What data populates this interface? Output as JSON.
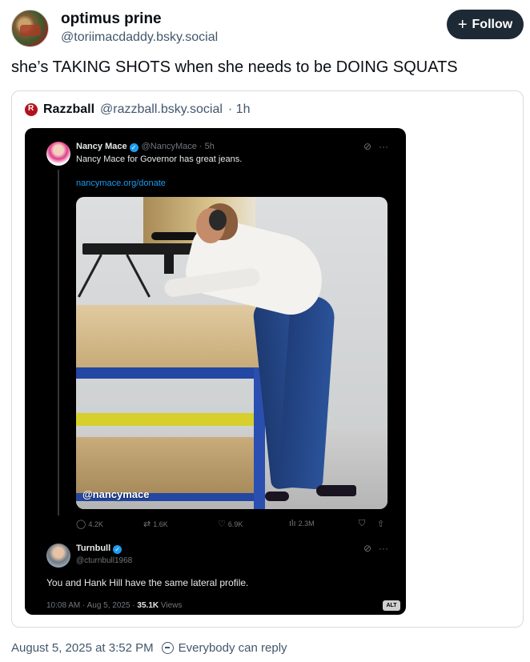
{
  "post": {
    "author_name": "optimus prine",
    "author_handle": "@toriimacdaddy.bsky.social",
    "follow_label": "Follow",
    "text": "she’s TAKING SHOTS when she needs to be DOING SQUATS",
    "timestamp": "August 5, 2025 at 3:52 PM",
    "reply_setting": "Everybody can reply"
  },
  "quote": {
    "author_name": "Razzball",
    "author_handle": "@razzball.bsky.social",
    "age": "· 1h"
  },
  "embed": {
    "tweet": {
      "name": "Nancy Mace",
      "handle_time": "@NancyMace · 5h",
      "text": "Nancy Mace for Governor has great jeans.",
      "link": "nancymace.org/donate",
      "photo_watermark": "@nancymace",
      "stats": {
        "replies": "4.2K",
        "reposts": "1.6K",
        "likes": "6.9K",
        "views": "2.3M"
      }
    },
    "reply": {
      "name": "Turnbull",
      "handle": "@cturnbull1968",
      "text": "You and Hank Hill have the same lateral profile.",
      "meta_time": "10:08 AM · Aug 5, 2025 · ",
      "meta_views_count": "35.1K",
      "meta_views_label": " Views"
    },
    "alt_badge": "ALT"
  },
  "icons": {
    "verified": "verified-check-icon",
    "grok": "grok-icon",
    "more": "more-icon",
    "reply": "reply-icon",
    "repost": "repost-icon",
    "like": "heart-icon",
    "views": "views-icon",
    "bookmark": "bookmark-icon",
    "share": "share-icon"
  },
  "colors": {
    "follow_bg": "#1e2936",
    "text_secondary": "#42576c",
    "embed_bg": "#000000",
    "link_blue": "#1d9bf0"
  }
}
